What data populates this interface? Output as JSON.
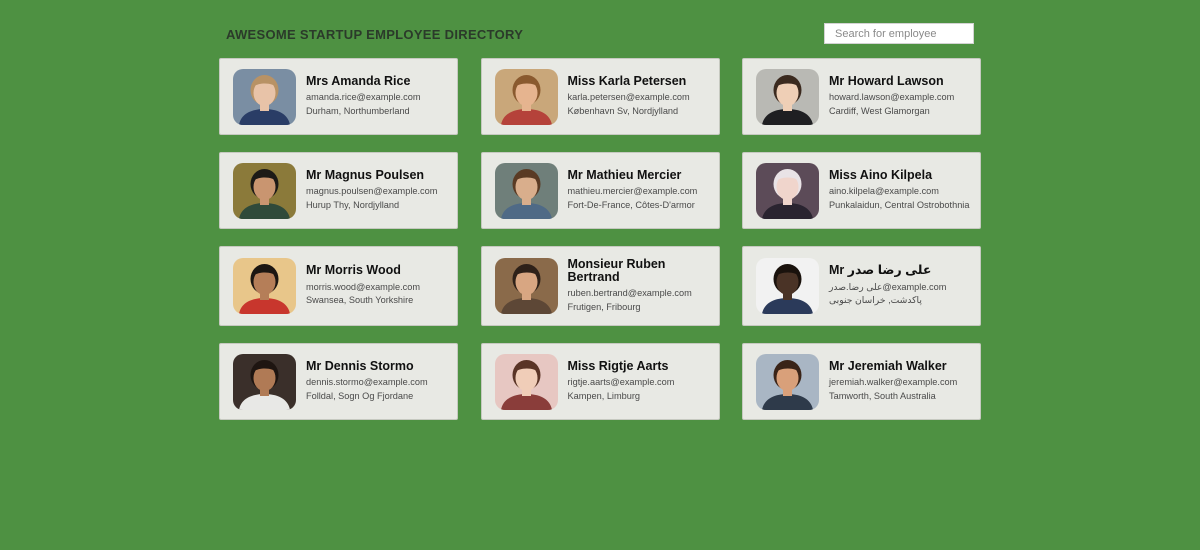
{
  "header": {
    "title": "AWESOME STARTUP EMPLOYEE DIRECTORY"
  },
  "search": {
    "placeholder": "Search for employee",
    "value": ""
  },
  "employees": [
    {
      "name": "Mrs Amanda Rice",
      "email": "amanda.rice@example.com",
      "location": "Durham, Northumberland",
      "avatar": {
        "bg": "#7a8ea3",
        "skin": "#e8c3a8",
        "hair": "#b89265",
        "shirt": "#2a3d66"
      }
    },
    {
      "name": "Miss Karla Petersen",
      "email": "karla.petersen@example.com",
      "location": "København Sv, Nordjylland",
      "avatar": {
        "bg": "#c9a77a",
        "skin": "#e6b48f",
        "hair": "#8a5a2f",
        "shirt": "#b5423a"
      }
    },
    {
      "name": "Mr Howard Lawson",
      "email": "howard.lawson@example.com",
      "location": "Cardiff, West Glamorgan",
      "avatar": {
        "bg": "#b9b9b4",
        "skin": "#efcfb6",
        "hair": "#3b2a1f",
        "shirt": "#1f1f22"
      }
    },
    {
      "name": "Mr Magnus Poulsen",
      "email": "magnus.poulsen@example.com",
      "location": "Hurup Thy, Nordjylland",
      "avatar": {
        "bg": "#8b7a3a",
        "skin": "#c99570",
        "hair": "#1c1a17",
        "shirt": "#2f4a3a"
      }
    },
    {
      "name": "Mr Mathieu Mercier",
      "email": "mathieu.mercier@example.com",
      "location": "Fort-De-France, Côtes-D'armor",
      "avatar": {
        "bg": "#6f7f7a",
        "skin": "#d9ae8c",
        "hair": "#5a3b24",
        "shirt": "#4f6a86"
      }
    },
    {
      "name": "Miss Aino Kilpela",
      "email": "aino.kilpela@example.com",
      "location": "Punkalaidun, Central Ostrobothnia",
      "avatar": {
        "bg": "#5c4b58",
        "skin": "#f0d5cc",
        "hair": "#e9e3e6",
        "shirt": "#2a2430"
      }
    },
    {
      "name": "Mr Morris Wood",
      "email": "morris.wood@example.com",
      "location": "Swansea, South Yorkshire",
      "avatar": {
        "bg": "#e8c68a",
        "skin": "#b57e58",
        "hair": "#1c1612",
        "shirt": "#c8362d"
      }
    },
    {
      "name": "Monsieur Ruben Bertrand",
      "email": "ruben.bertrand@example.com",
      "location": "Frutigen, Fribourg",
      "avatar": {
        "bg": "#8a6a4a",
        "skin": "#d8a682",
        "hair": "#2e2119",
        "shirt": "#5d4736"
      }
    },
    {
      "name": "Mr علی رضا صدر",
      "email": "علی رضا.صدر@example.com",
      "location": "پاکدشت, خراسان جنوبی",
      "avatar": {
        "bg": "#f2f2f2",
        "skin": "#4a3326",
        "hair": "#1a120d",
        "shirt": "#2b3a5a"
      }
    },
    {
      "name": "Mr Dennis Stormo",
      "email": "dennis.stormo@example.com",
      "location": "Folldal, Sogn Og Fjordane",
      "avatar": {
        "bg": "#3a2f2a",
        "skin": "#b07a55",
        "hair": "#1e1511",
        "shirt": "#e8e8e6"
      }
    },
    {
      "name": "Miss Rigtje Aarts",
      "email": "rigtje.aarts@example.com",
      "location": "Kampen, Limburg",
      "avatar": {
        "bg": "#e7c7c2",
        "skin": "#f0cdb8",
        "hair": "#5a3426",
        "shirt": "#8a3d3a"
      }
    },
    {
      "name": "Mr Jeremiah Walker",
      "email": "jeremiah.walker@example.com",
      "location": "Tamworth, South Australia",
      "avatar": {
        "bg": "#a9b6c4",
        "skin": "#d9a07a",
        "hair": "#3a2418",
        "shirt": "#2e3a4a"
      }
    }
  ]
}
